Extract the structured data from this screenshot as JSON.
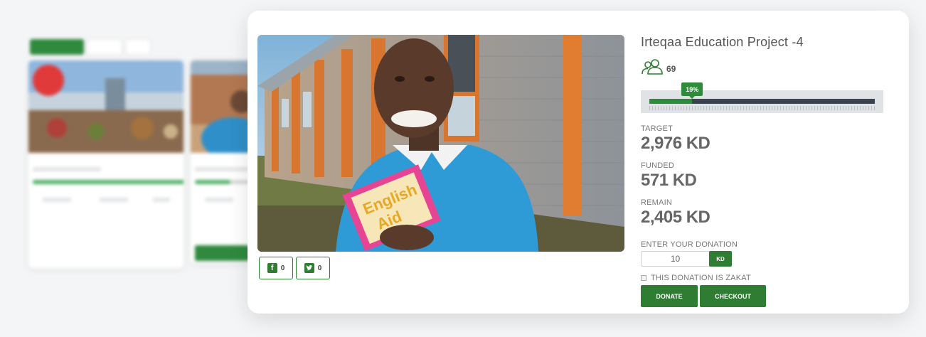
{
  "project": {
    "title": "Irteqaa Education Project -4",
    "donors_count": "69",
    "progress_label": "19%",
    "progress_percent": 19
  },
  "stats": {
    "target_label": "TARGET",
    "target_value": "2,976 KD",
    "funded_label": "FUNDED",
    "funded_value": "571 KD",
    "remain_label": "REMAIN",
    "remain_value": "2,405 KD"
  },
  "donation": {
    "label": "ENTER YOUR DONATION",
    "amount": "10",
    "currency_button": "KD",
    "zakat_label": "THIS DONATION IS ZAKAT",
    "donate_button": "DONATE",
    "checkout_button": "CHECKOUT"
  },
  "share": {
    "facebook_count": "0",
    "twitter_count": "0"
  },
  "icons": {
    "donors": "users-icon",
    "facebook": "facebook-icon",
    "twitter": "twitter-icon"
  },
  "colors": {
    "brand_green": "#2e7d32",
    "progress_fill": "#2e8b3a",
    "progress_track": "#3a4450"
  }
}
